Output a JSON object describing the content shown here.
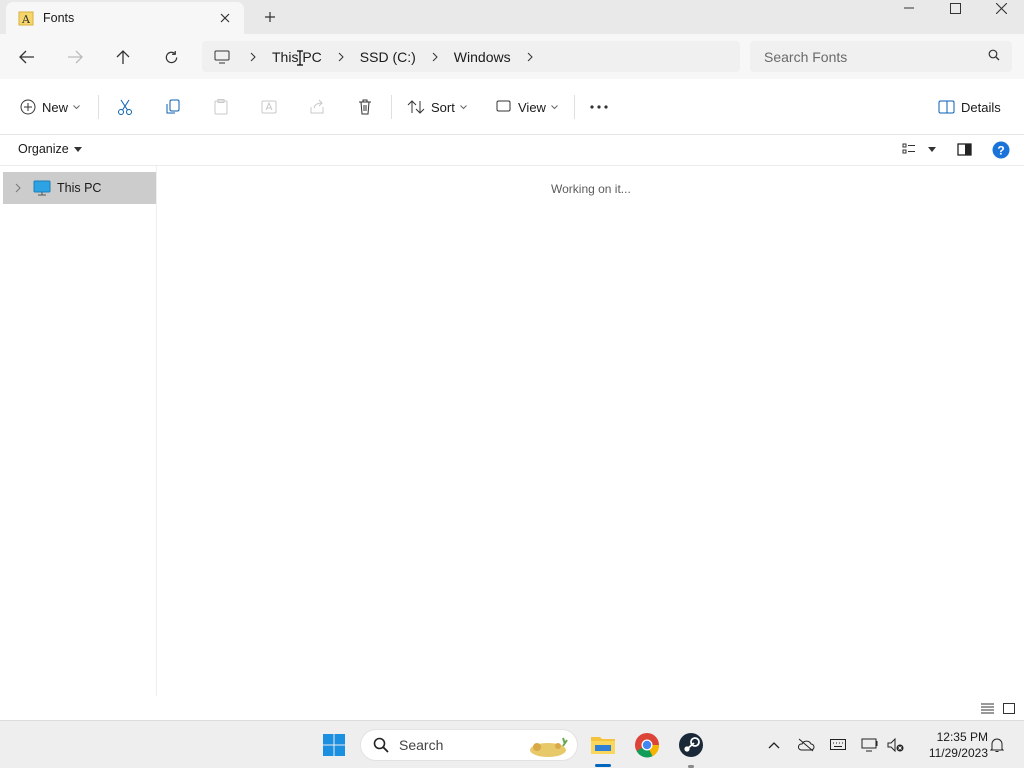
{
  "tab": {
    "title": "Fonts"
  },
  "address": {
    "crumbs": [
      "This PC",
      "SSD (C:)",
      "Windows"
    ]
  },
  "search": {
    "placeholder": "Search Fonts"
  },
  "commands": {
    "new": "New",
    "sort": "Sort",
    "view": "View",
    "details": "Details"
  },
  "organize": {
    "label": "Organize"
  },
  "nav": {
    "this_pc": "This PC"
  },
  "content": {
    "status": "Working on it..."
  },
  "taskbar": {
    "search_placeholder": "Search",
    "time": "12:35 PM",
    "date": "11/29/2023"
  },
  "colors": {
    "accent": "#0067c0",
    "selected_nav": "#cccccc"
  }
}
